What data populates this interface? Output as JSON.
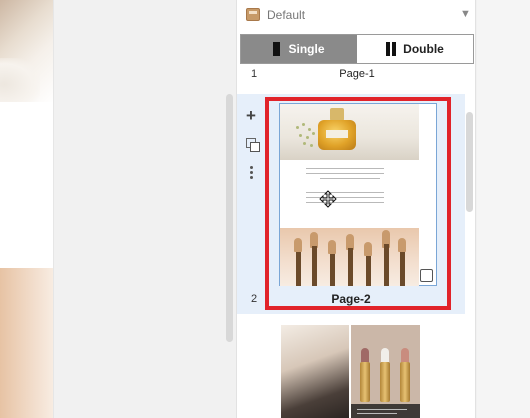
{
  "panel": {
    "header": {
      "title": "Default",
      "icon": "book-icon",
      "caret": "▼"
    },
    "mode_toggle": {
      "single_label": "Single",
      "double_label": "Double",
      "active": "single"
    },
    "pages": [
      {
        "number": "1",
        "label": "Page-1"
      },
      {
        "number": "2",
        "label": "Page-2",
        "selected": true
      }
    ],
    "tools": {
      "add": "+"
    }
  },
  "colors": {
    "selection_outline": "#e1232a",
    "selected_row_bg": "#e6effa",
    "active_toggle_bg": "#8a8a8a"
  }
}
